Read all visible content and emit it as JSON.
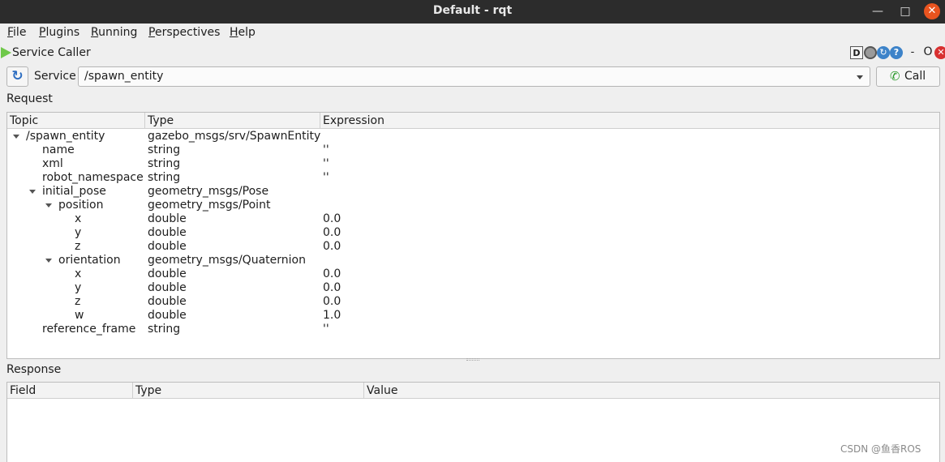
{
  "window": {
    "title": "Default - rqt",
    "minimize_icon": "minimize-icon",
    "maximize_icon": "maximize-icon",
    "close_icon": "close-icon"
  },
  "menu": [
    {
      "first": "F",
      "rest": "ile"
    },
    {
      "first": "P",
      "rest": "lugins"
    },
    {
      "first": "R",
      "rest": "unning"
    },
    {
      "first": "P",
      "rest": "erspectives"
    },
    {
      "first": "H",
      "rest": "elp"
    }
  ],
  "plugin": {
    "title": "Service Caller",
    "d_label": "D",
    "q_label": "?",
    "dash_label": "-",
    "o_label": "O"
  },
  "service": {
    "label": "Service",
    "value": "/spawn_entity",
    "call_label": "Call"
  },
  "request": {
    "label": "Request",
    "headers": [
      "Topic",
      "Type",
      "Expression"
    ],
    "rows": [
      {
        "topic": "/spawn_entity",
        "type": "gazebo_msgs/srv/SpawnEntity",
        "expr": "",
        "level": 0,
        "expanded": true
      },
      {
        "topic": "name",
        "type": "string",
        "expr": "''",
        "level": 1,
        "expanded": false
      },
      {
        "topic": "xml",
        "type": "string",
        "expr": "''",
        "level": 1,
        "expanded": false
      },
      {
        "topic": "robot_namespace",
        "type": "string",
        "expr": "''",
        "level": 1,
        "expanded": false
      },
      {
        "topic": "initial_pose",
        "type": "geometry_msgs/Pose",
        "expr": "",
        "level": 1,
        "expanded": true
      },
      {
        "topic": "position",
        "type": "geometry_msgs/Point",
        "expr": "",
        "level": 2,
        "expanded": true
      },
      {
        "topic": "x",
        "type": "double",
        "expr": "0.0",
        "level": 3,
        "expanded": false
      },
      {
        "topic": "y",
        "type": "double",
        "expr": "0.0",
        "level": 3,
        "expanded": false
      },
      {
        "topic": "z",
        "type": "double",
        "expr": "0.0",
        "level": 3,
        "expanded": false
      },
      {
        "topic": "orientation",
        "type": "geometry_msgs/Quaternion",
        "expr": "",
        "level": 2,
        "expanded": true
      },
      {
        "topic": "x",
        "type": "double",
        "expr": "0.0",
        "level": 3,
        "expanded": false
      },
      {
        "topic": "y",
        "type": "double",
        "expr": "0.0",
        "level": 3,
        "expanded": false
      },
      {
        "topic": "z",
        "type": "double",
        "expr": "0.0",
        "level": 3,
        "expanded": false
      },
      {
        "topic": "w",
        "type": "double",
        "expr": "1.0",
        "level": 3,
        "expanded": false
      },
      {
        "topic": "reference_frame",
        "type": "string",
        "expr": "''",
        "level": 1,
        "expanded": false
      }
    ]
  },
  "response": {
    "label": "Response",
    "headers": [
      "Field",
      "Type",
      "Value"
    ]
  },
  "watermark": "CSDN @鱼香ROS"
}
